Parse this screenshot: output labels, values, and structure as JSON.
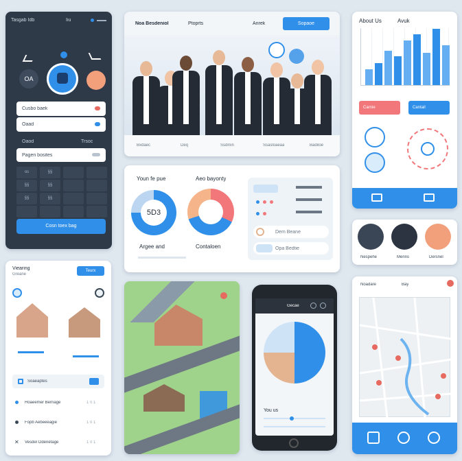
{
  "dark_panel": {
    "header_title": "Tasgab Idb",
    "header_right": "Iiu",
    "circle_left_label": "OA",
    "row1_label": "Cusbo baek",
    "row2_label": "Oaad",
    "mid_label_left": "Oaod",
    "mid_label_right": "Trsoc",
    "select_label": "Pagen bosites",
    "grid": [
      "os",
      "§§",
      "",
      "",
      "§§",
      "§§",
      "",
      "",
      "§§",
      "§§",
      "",
      "",
      "",
      "",
      "",
      ""
    ],
    "bottom_button": "Cosn toex bag"
  },
  "hero": {
    "nav_logo": "Noa Besdeniol",
    "nav_item1": "Ptoprts",
    "nav_item2": "Anrek",
    "nav_button": "Sopaoe",
    "captions": [
      "Bxdaec",
      "Deq",
      "Ssdmin",
      "Ssasloaeaa",
      "Badiloe"
    ]
  },
  "analytics": {
    "left_title": "Youn fe pue",
    "left_value": "5D3",
    "left_caption": "Argee and",
    "mid_title": "Aeo bayonty",
    "mid_caption": "Contaloen",
    "item1": "Dem Beane",
    "item2": "Opa Bedtie"
  },
  "right_top": {
    "title": "About Us",
    "title_right": "Avuk",
    "bars": [
      22,
      30,
      48,
      40,
      62,
      70,
      45,
      78,
      55
    ],
    "pill1": "Carnie",
    "pill2": "Cantail"
  },
  "team": {
    "names": [
      "Nespehe",
      "Menns",
      "Dersnel"
    ]
  },
  "left_bottom": {
    "title": "Viearing",
    "subtitle": "Greane",
    "button": "Teurx",
    "search_label": "Soaeaptes",
    "list": [
      {
        "label": "Hoaeemer Bernage",
        "meta": "1 0 1"
      },
      {
        "label": "Fopb Aebeeeagie",
        "meta": "1 0 1"
      },
      {
        "label": "Vesdel Odenetage",
        "meta": "1 0 1"
      }
    ]
  },
  "phone": {
    "header": "Gecae",
    "footer_title": "You us",
    "colors": {
      "accent": "#2f8fe9",
      "tan": "#e3b48f"
    }
  },
  "map": {
    "tab1": "Noadare",
    "tab2": "Bay"
  }
}
